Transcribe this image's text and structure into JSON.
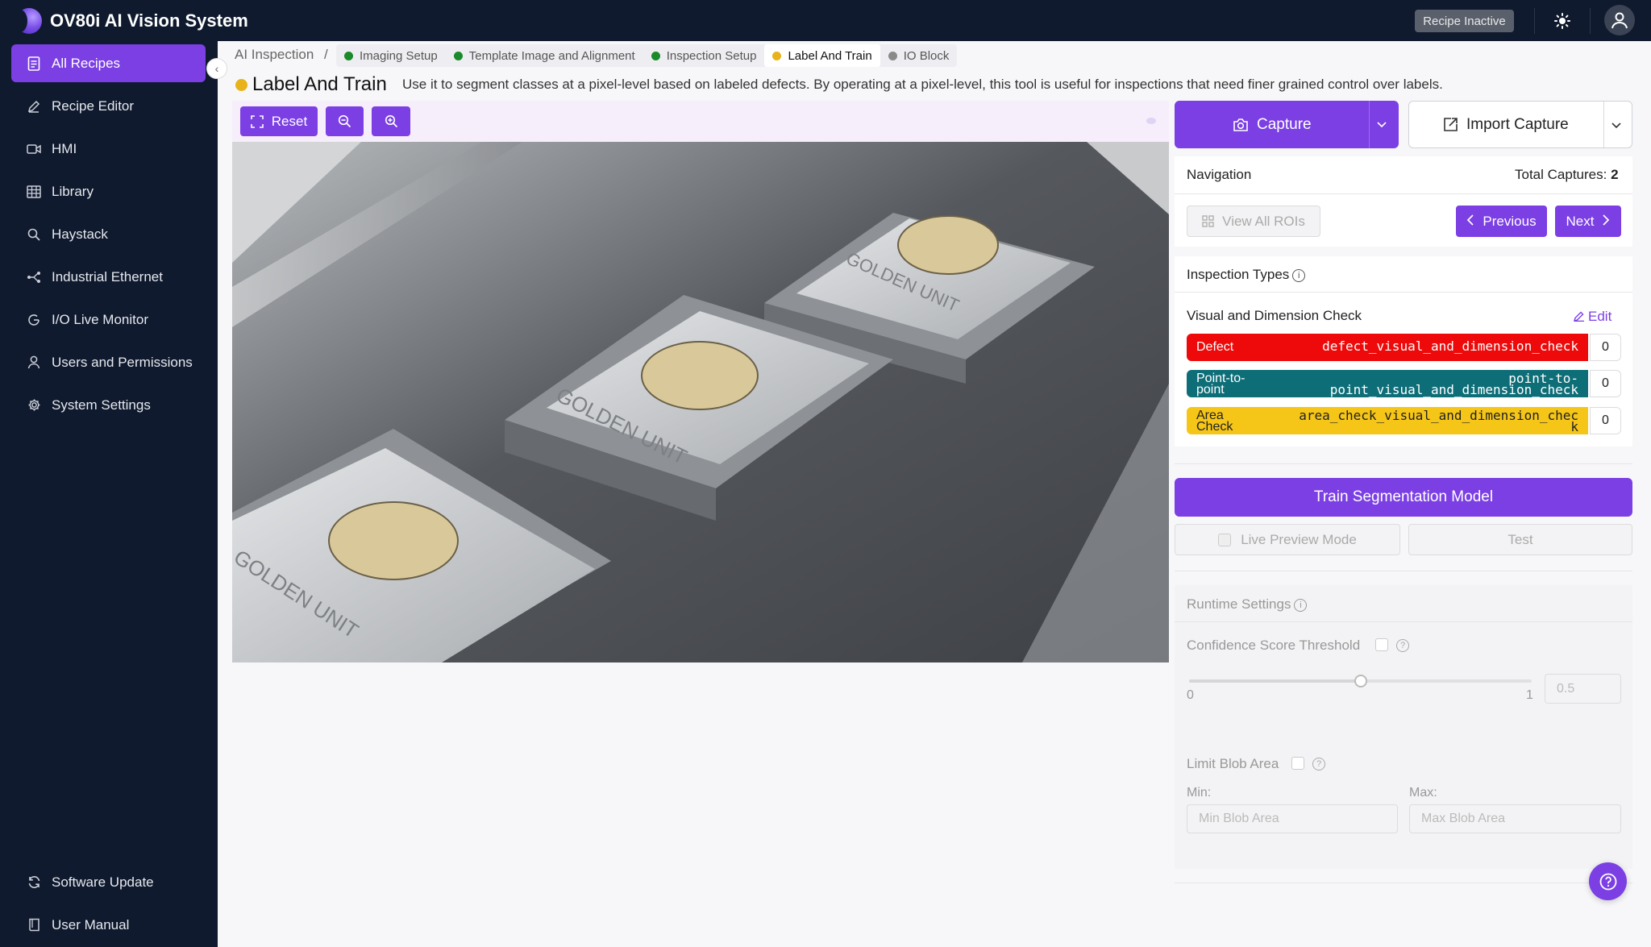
{
  "app": {
    "title": "OV80i AI Vision System",
    "status_badge": "Recipe Inactive"
  },
  "sidebar": {
    "items": [
      {
        "label": "All Recipes",
        "icon": "document-icon",
        "active": true
      },
      {
        "label": "Recipe Editor",
        "icon": "pencil-icon"
      },
      {
        "label": "HMI",
        "icon": "video-icon"
      },
      {
        "label": "Library",
        "icon": "table-icon"
      },
      {
        "label": "Haystack",
        "icon": "search-icon"
      },
      {
        "label": "Industrial Ethernet",
        "icon": "network-icon"
      },
      {
        "label": "I/O Live Monitor",
        "icon": "monitor-icon"
      },
      {
        "label": "Users and Permissions",
        "icon": "user-icon"
      },
      {
        "label": "System Settings",
        "icon": "gear-icon"
      }
    ],
    "footer": [
      {
        "label": "Software Update",
        "icon": "refresh-icon"
      },
      {
        "label": "User Manual",
        "icon": "book-icon"
      }
    ]
  },
  "breadcrumb": {
    "root": "AI Inspection",
    "separator": "/",
    "steps": [
      {
        "label": "Imaging Setup",
        "color": "#1a8a2a"
      },
      {
        "label": "Template Image and Alignment",
        "color": "#1a8a2a"
      },
      {
        "label": "Inspection Setup",
        "color": "#1a8a2a"
      },
      {
        "label": "Label And Train",
        "color": "#e8b21c",
        "active": true
      },
      {
        "label": "IO Block",
        "color": "#8a8a8a"
      }
    ]
  },
  "page": {
    "title": "Label And Train",
    "description": "Use it to segment classes at a pixel-level based on labeled defects. By operating at a pixel-level, this tool is useful for inspections that need finer grained control over labels."
  },
  "toolbar": {
    "reset_label": "Reset"
  },
  "capture": {
    "capture_label": "Capture",
    "import_label": "Import Capture"
  },
  "navigation": {
    "title": "Navigation",
    "total_label": "Total Captures:",
    "total_value": "2",
    "view_all_label": "View All ROIs",
    "previous_label": "Previous",
    "next_label": "Next"
  },
  "inspection_types": {
    "title": "Inspection Types",
    "group_name": "Visual and Dimension Check",
    "edit_label": "Edit",
    "types": [
      {
        "name": "Defect",
        "key": "defect_visual_and_dimension_check",
        "count": "0",
        "bg": "#ee0a0a",
        "fg": "#ffffff"
      },
      {
        "name_l1": "Point-to-",
        "name_l2": "point",
        "key_l1": "point-to-",
        "key_l2": "point_visual_and_dimension_check",
        "count": "0",
        "bg": "#0e6e78",
        "fg": "#ffffff"
      },
      {
        "name_l1": "Area",
        "name_l2": "Check",
        "key_l1": "area_check_visual_and_dimension_chec",
        "key_l2": "k",
        "count": "0",
        "bg": "#f5c518",
        "fg": "#222222"
      }
    ]
  },
  "training": {
    "train_label": "Train Segmentation Model",
    "live_preview_label": "Live Preview Mode",
    "test_label": "Test"
  },
  "runtime": {
    "title": "Runtime Settings",
    "confidence_label": "Confidence Score Threshold",
    "slider_min": "0",
    "slider_max": "1",
    "slider_value": "0.5",
    "slider_fraction": 0.5,
    "blob_label": "Limit Blob Area",
    "min_label": "Min:",
    "max_label": "Max:",
    "min_placeholder": "Min Blob Area",
    "max_placeholder": "Max Blob Area"
  },
  "colors": {
    "accent": "#7b3fe4",
    "sidebar_bg": "#0f1a2e"
  }
}
